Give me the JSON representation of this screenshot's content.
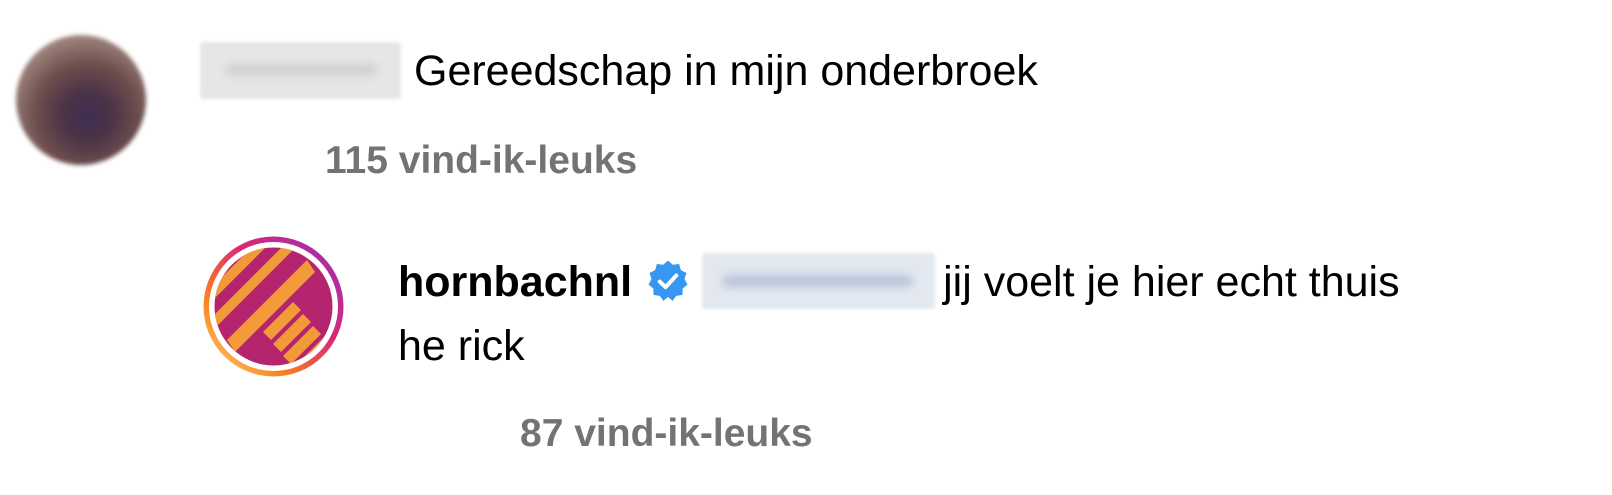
{
  "comment": {
    "username_redacted": true,
    "text": "Gereedschap in mijn onderbroek",
    "likes": "115 vind-ik-leuks"
  },
  "reply": {
    "username": "hornbachnl",
    "verified": true,
    "verified_icon": "verified-badge-icon",
    "mention_redacted": true,
    "text_part1": "jij voelt je hier echt thuis",
    "text_part2": "he rick",
    "likes": "87 vind-ik-leuks"
  },
  "colors": {
    "likes_text": "#737373",
    "verified_badge": "#3897F0",
    "brand_orange": "#F29A38",
    "brand_magenta": "#B5246E"
  }
}
